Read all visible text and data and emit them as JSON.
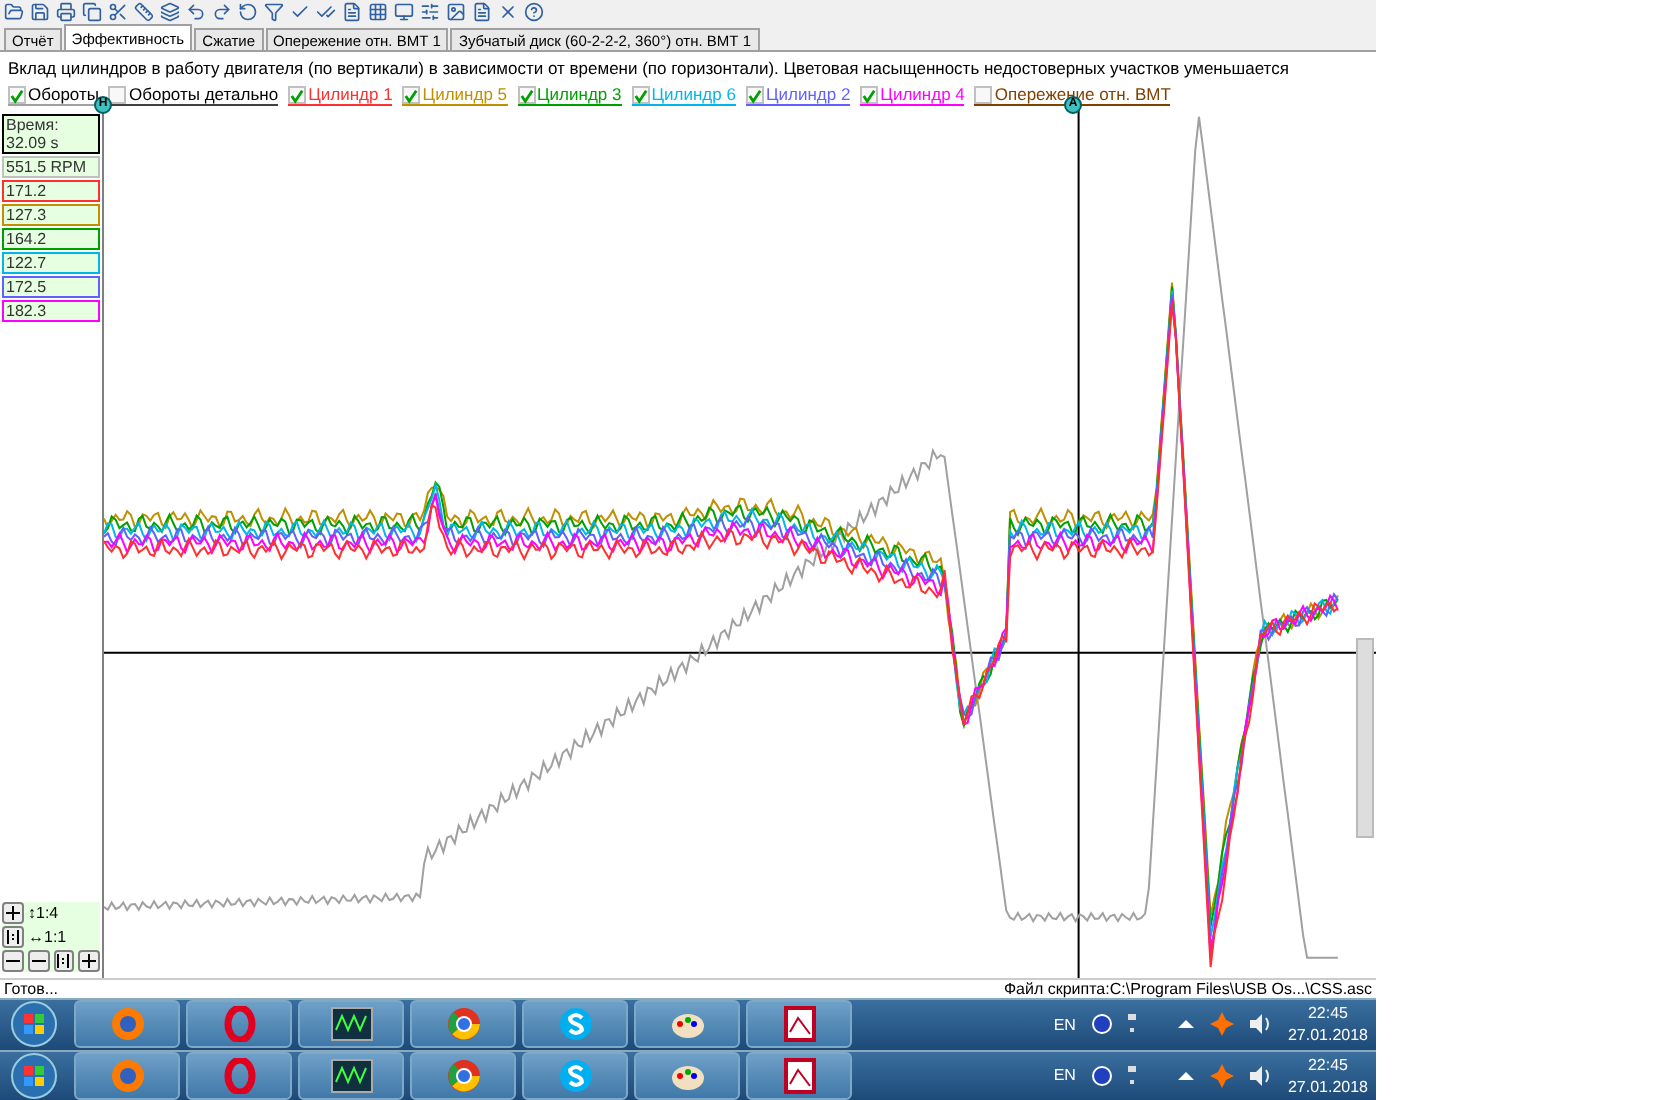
{
  "tabs": [
    {
      "label": "Отчёт",
      "selected": false
    },
    {
      "label": "Эффективность",
      "selected": true
    },
    {
      "label": "Сжатие",
      "selected": false
    },
    {
      "label": "Опережение отн. ВМТ 1",
      "selected": false
    },
    {
      "label": "Зубчатый диск (60-2-2-2, 360°) отн. ВМТ 1",
      "selected": false
    }
  ],
  "description": "Вклад цилиндров в работу двигателя (по вертикали) в зависимости от времени (по горизонтали). Цветовая насыщенность недостоверных участков уменьшается",
  "legend": [
    {
      "label": "Обороты",
      "checked": true,
      "color": "#a0a0a0"
    },
    {
      "label": "Обороты детально",
      "checked": false,
      "color": "#404040"
    },
    {
      "label": "Цилиндр 1",
      "checked": true,
      "color": "#ff3030"
    },
    {
      "label": "Цилиндр 5",
      "checked": true,
      "color": "#c09000"
    },
    {
      "label": "Цилиндр 3",
      "checked": true,
      "color": "#00a000"
    },
    {
      "label": "Цилиндр 6",
      "checked": true,
      "color": "#00b8e8"
    },
    {
      "label": "Цилиндр 2",
      "checked": true,
      "color": "#6060ff"
    },
    {
      "label": "Цилиндр 4",
      "checked": true,
      "color": "#ff00ff"
    },
    {
      "label": "Опережение отн. ВМТ",
      "checked": false,
      "color": "#804000"
    }
  ],
  "markers": [
    {
      "label": "H"
    },
    {
      "label": "A"
    }
  ],
  "readings": [
    {
      "text": "Время:\n32.09 s",
      "color": "#000000"
    },
    {
      "text": "551.5 RPM",
      "color": "#c0c0c0"
    },
    {
      "text": "171.2",
      "color": "#ff3030"
    },
    {
      "text": "127.3",
      "color": "#c09000"
    },
    {
      "text": "164.2",
      "color": "#00a000"
    },
    {
      "text": "122.7",
      "color": "#00b8e8"
    },
    {
      "text": "172.5",
      "color": "#6060ff"
    },
    {
      "text": "182.3",
      "color": "#ff00ff"
    }
  ],
  "scale": {
    "vertical": "↕1:4",
    "horizontal": "↔1:1"
  },
  "status": {
    "left": "Готов...",
    "right": "Файл скрипта:C:\\Program Files\\USB Os...\\CSS.asc"
  },
  "taskbars": [
    {
      "language": "EN",
      "time": "22:45",
      "date": "27.01.2018"
    },
    {
      "language": "EN",
      "time": "22:45",
      "date": "27.01.2018"
    }
  ]
}
